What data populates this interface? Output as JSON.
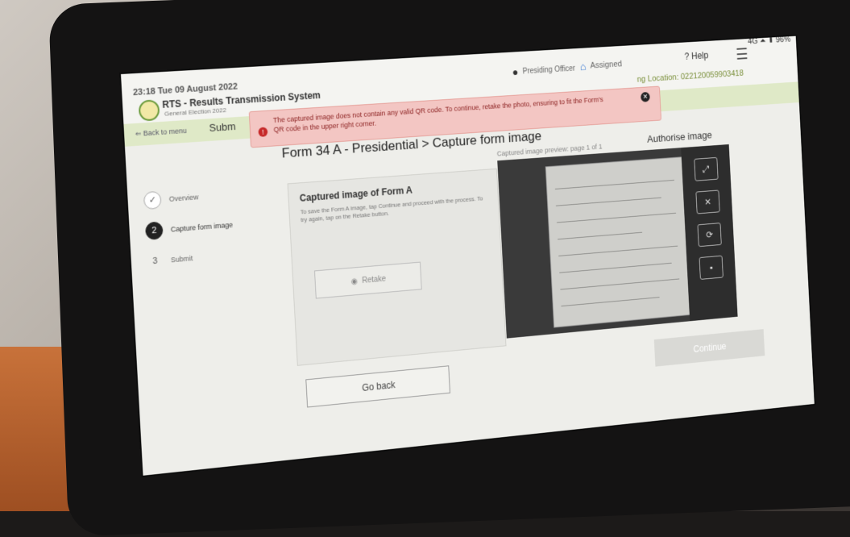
{
  "status_bar": {
    "right": "4G ⏶ ▮ 96%"
  },
  "app": {
    "datetime": "23:18 Tue 09 August 2022",
    "title": "RTS - Results Transmission System",
    "subtitle": "General Election 2022"
  },
  "header": {
    "role": "Presiding Officer",
    "assigned": "Assigned",
    "help": "? Help",
    "location": "ng Location: 022120059903418"
  },
  "nav": {
    "back": "⇐ Back to menu",
    "tab": "Subm"
  },
  "alert": {
    "message": "The captured image does not contain any valid QR code. To continue, retake the photo, ensuring to fit the Form's QR code in the upper right corner."
  },
  "page": {
    "title": "Form 34 A - Presidential > Capture form image"
  },
  "steps": [
    {
      "label": "Overview"
    },
    {
      "number": "2",
      "label": "Capture form image"
    },
    {
      "number": "3",
      "label": "Submit"
    }
  ],
  "card": {
    "title": "Captured image of Form A",
    "description": "To save the Form A image, tap Continue and proceed with the process. To try again, tap on the Retake button.",
    "retake_label": "Retake"
  },
  "preview": {
    "label": "Captured image preview: page 1 of 1",
    "authorise": "Authorise image",
    "tools": [
      "⤢",
      "✕",
      "⟳",
      "▪"
    ]
  },
  "buttons": {
    "go_back": "Go back",
    "continue": "Continue"
  }
}
